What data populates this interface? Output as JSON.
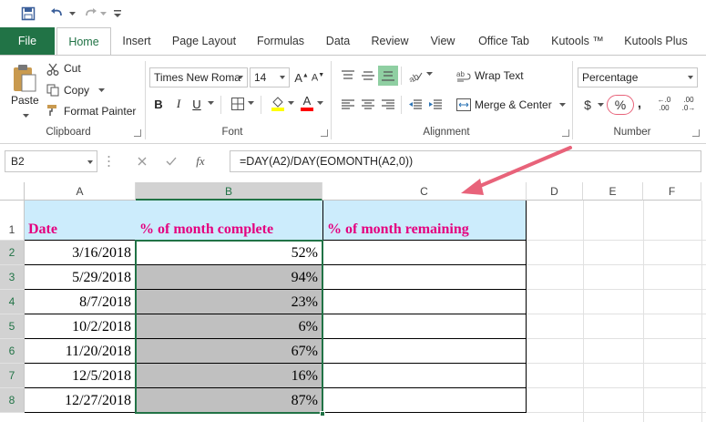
{
  "tabs": {
    "file": "File",
    "items": [
      "Home",
      "Insert",
      "Page Layout",
      "Formulas",
      "Data",
      "Review",
      "View",
      "Office Tab",
      "Kutools ™",
      "Kutools Plus"
    ]
  },
  "clipboard": {
    "paste": "Paste",
    "cut": "Cut",
    "copy": "Copy",
    "format_painter": "Format Painter",
    "label": "Clipboard"
  },
  "font": {
    "name": "Times New Roma",
    "size": "14",
    "bold": "B",
    "italic": "I",
    "underline": "U",
    "font_color_glyph": "A",
    "label": "Font"
  },
  "alignment": {
    "wrap_text": "Wrap Text",
    "merge_center": "Merge & Center",
    "label": "Alignment"
  },
  "number": {
    "format": "Percentage",
    "currency": "$",
    "percent": "%",
    "comma": ",",
    "inc_decimal": ".00",
    "dec_decimal": ".0",
    "label": "Number"
  },
  "formula_bar": {
    "name_box": "B2",
    "fx": "fx",
    "formula": "=DAY(A2)/DAY(EOMONTH(A2,0))"
  },
  "sheet": {
    "columns": [
      "A",
      "B",
      "C",
      "D",
      "E",
      "F"
    ],
    "row_numbers": [
      "1",
      "2",
      "3",
      "4",
      "5",
      "6",
      "7",
      "8"
    ],
    "header": {
      "date": "Date",
      "complete": "% of month complete",
      "remaining": "% of month remaining"
    },
    "rows": [
      {
        "date": "3/16/2018",
        "complete": "52%"
      },
      {
        "date": "5/29/2018",
        "complete": "94%"
      },
      {
        "date": "8/7/2018",
        "complete": "23%"
      },
      {
        "date": "10/2/2018",
        "complete": "6%"
      },
      {
        "date": "11/20/2018",
        "complete": "67%"
      },
      {
        "date": "12/5/2018",
        "complete": "16%"
      },
      {
        "date": "12/27/2018",
        "complete": "87%"
      }
    ]
  },
  "colors": {
    "excel_green": "#217346",
    "header_fill": "#ccecfc",
    "header_text": "#e4007f",
    "selection_fill": "#c0c0c0",
    "arrow": "#e8637a"
  }
}
